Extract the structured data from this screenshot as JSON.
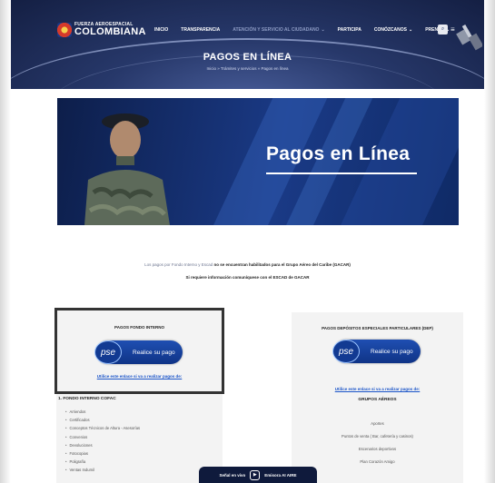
{
  "header": {
    "logo_small": "FUERZA AEROESPACIAL",
    "logo_big": "COLOMBIANA",
    "nav": [
      {
        "label": "INICIO",
        "has_chevron": false,
        "dim": false
      },
      {
        "label": "TRANSPARENCIA",
        "has_chevron": false,
        "dim": false
      },
      {
        "label": "ATENCIÓN Y SERVICIO AL CIUDADANO",
        "has_chevron": true,
        "dim": true
      },
      {
        "label": "PARTICIPA",
        "has_chevron": false,
        "dim": false
      },
      {
        "label": "CONÓZCANOS",
        "has_chevron": true,
        "dim": false
      },
      {
        "label": "PRENSA",
        "has_chevron": true,
        "dim": false
      }
    ],
    "title": "PAGOS EN LÍNEA",
    "breadcrumb": "Inicio  »  Trámites y servicios  »  Pagos en línea"
  },
  "banner": {
    "title": "Pagos en Línea"
  },
  "notice": {
    "line1_prefix": "Los pagos por Fondo Interno y Escad ",
    "line1_bold": "no se encuentran habilitados para el Grupo Aéreo del Caribe (GACAR)",
    "line2": "Si requiere información comuníquese con el ESCAD de GACAR"
  },
  "left_panel": {
    "heading": "PAGOS FONDO INTERNO",
    "pse_logo": "pse",
    "pse_label": "Realice su pago",
    "link": "Utilice este enlace si va a realizar pagos de:",
    "list_title": "1. FONDO INTERNO COFAC",
    "items": [
      "Arriendos",
      "Certificados",
      "Conceptos Técnicos de Altura - Asesorías",
      "Convenios",
      "Devoluciones",
      "Fotocopias",
      "Poligrafía",
      "Ventas Indumil"
    ]
  },
  "right_panel": {
    "heading": "PAGOS DEPÓSITOS ESPECIALES PARTICULARES (DEP)",
    "pse_logo": "pse",
    "pse_label": "Realice su pago",
    "link": "Utilice este enlace si va a realizar pagos de:",
    "group_title": "GRUPOS AÉREOS",
    "items": [
      "Aportes",
      "Puntos de venta ( Bar, cafetería y casinos)",
      "Escenarios deportivos",
      "Plan Corazón Amigo"
    ]
  },
  "live_bar": {
    "left": "Señal en vivo",
    "right": "Emisora AI AIRE"
  },
  "colors": {
    "header_dark": "#141f43",
    "banner_blue": "#1a3a86",
    "link_blue": "#1b55c9",
    "highlight_border": "#333333"
  }
}
